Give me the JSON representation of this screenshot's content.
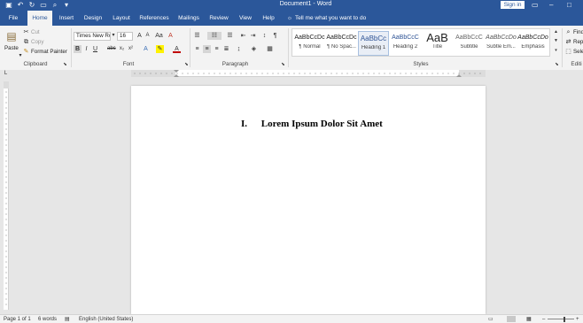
{
  "window": {
    "title": "Document1 - Word",
    "sign_in": "Sign in"
  },
  "tabs": [
    "File",
    "Home",
    "Insert",
    "Design",
    "Layout",
    "References",
    "Mailings",
    "Review",
    "View",
    "Help"
  ],
  "active_tab": "Home",
  "tell_me": "Tell me what you want to do",
  "clipboard": {
    "paste": "Paste",
    "cut": "Cut",
    "copy": "Copy",
    "format_painter": "Format Painter",
    "label": "Clipboard"
  },
  "font": {
    "name": "Times New Ro",
    "size": "16",
    "label": "Font"
  },
  "paragraph": {
    "label": "Paragraph"
  },
  "styles": {
    "label": "Styles",
    "items": [
      {
        "preview": "AaBbCcDc",
        "name": "¶ Normal"
      },
      {
        "preview": "AaBbCcDc",
        "name": "¶ No Spac..."
      },
      {
        "preview": "AaBbCc",
        "name": "Heading 1"
      },
      {
        "preview": "AaBbCcC",
        "name": "Heading 2"
      },
      {
        "preview": "AaB",
        "name": "Title"
      },
      {
        "preview": "AaBbCcC",
        "name": "Subtitle"
      },
      {
        "preview": "AaBbCcDo",
        "name": "Subtle Em..."
      },
      {
        "preview": "AaBbCcDo",
        "name": "Emphasis"
      }
    ]
  },
  "editing": {
    "find": "Find",
    "replace": "Repl",
    "select": "Sele",
    "label": "Editi"
  },
  "document": {
    "heading_number": "I.",
    "heading_text": "Lorem Ipsum Dolor Sit Amet"
  },
  "status": {
    "page": "Page 1 of 1",
    "words": "6 words",
    "language": "English (United States)"
  },
  "colors": {
    "brand": "#2b579a",
    "ribbon": "#f3f3f3",
    "canvas": "#e6e6e6"
  }
}
